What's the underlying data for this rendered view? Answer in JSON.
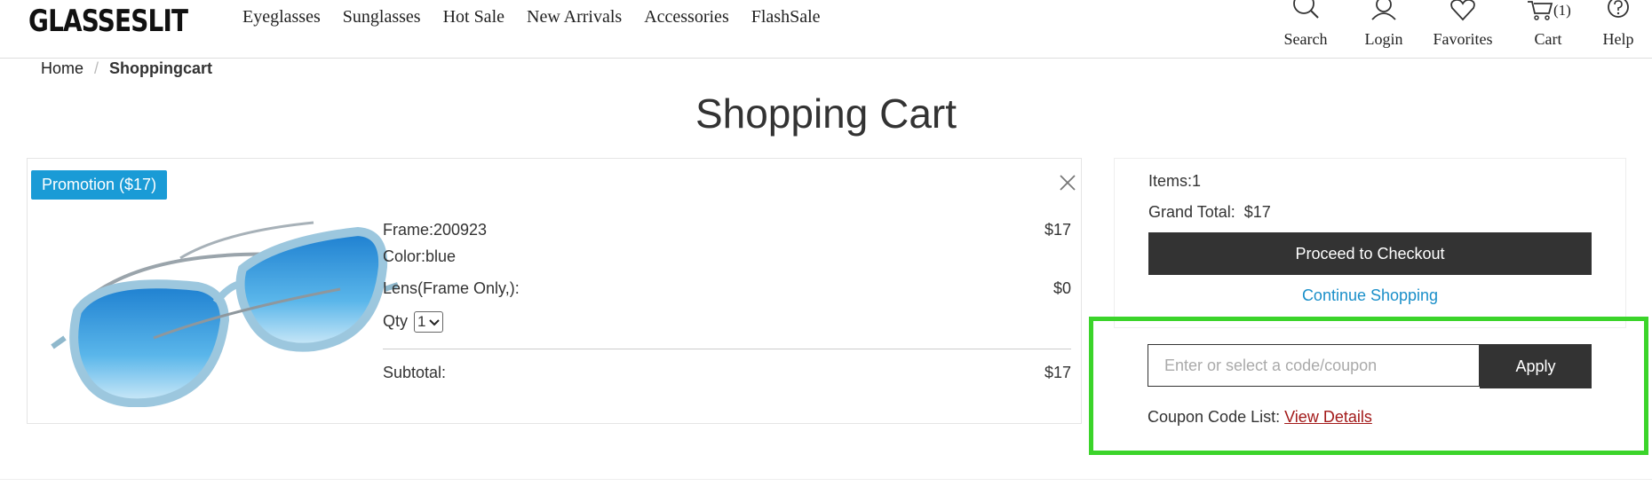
{
  "header": {
    "logo": "GLASSESLIT",
    "nav": [
      "Eyeglasses",
      "Sunglasses",
      "Hot Sale",
      "New Arrivals",
      "Accessories",
      "FlashSale"
    ],
    "icons": {
      "search": "Search",
      "login": "Login",
      "favorites": "Favorites",
      "cart": "Cart",
      "cart_count": "(1)",
      "help": "Help"
    }
  },
  "breadcrumb": {
    "home": "Home",
    "separator": "/",
    "current": "Shoppingcart"
  },
  "page_title": "Shopping Cart",
  "item": {
    "promotion": "Promotion ($17)",
    "frame": "Frame:200923",
    "frame_price": "$17",
    "color": "Color:blue",
    "lens": "Lens(Frame Only,):",
    "lens_price": "$0",
    "qty_label": "Qty",
    "qty_value": "1",
    "subtotal_label": "Subtotal:",
    "subtotal_value": "$17"
  },
  "summary": {
    "items": "Items:1",
    "grand_total": "Grand Total:  $17",
    "checkout": "Proceed to Checkout",
    "continue": "Continue Shopping"
  },
  "coupon": {
    "placeholder": "Enter or select a code/coupon",
    "apply": "Apply",
    "list_label": "Coupon Code List:",
    "view_details": "View Details"
  },
  "colors": {
    "promo_blue": "#1a9bd6",
    "link_blue": "#1a8fc9",
    "dark_button": "#333333",
    "highlight_green": "#3bd42a",
    "details_link_red": "#a31a1a"
  }
}
